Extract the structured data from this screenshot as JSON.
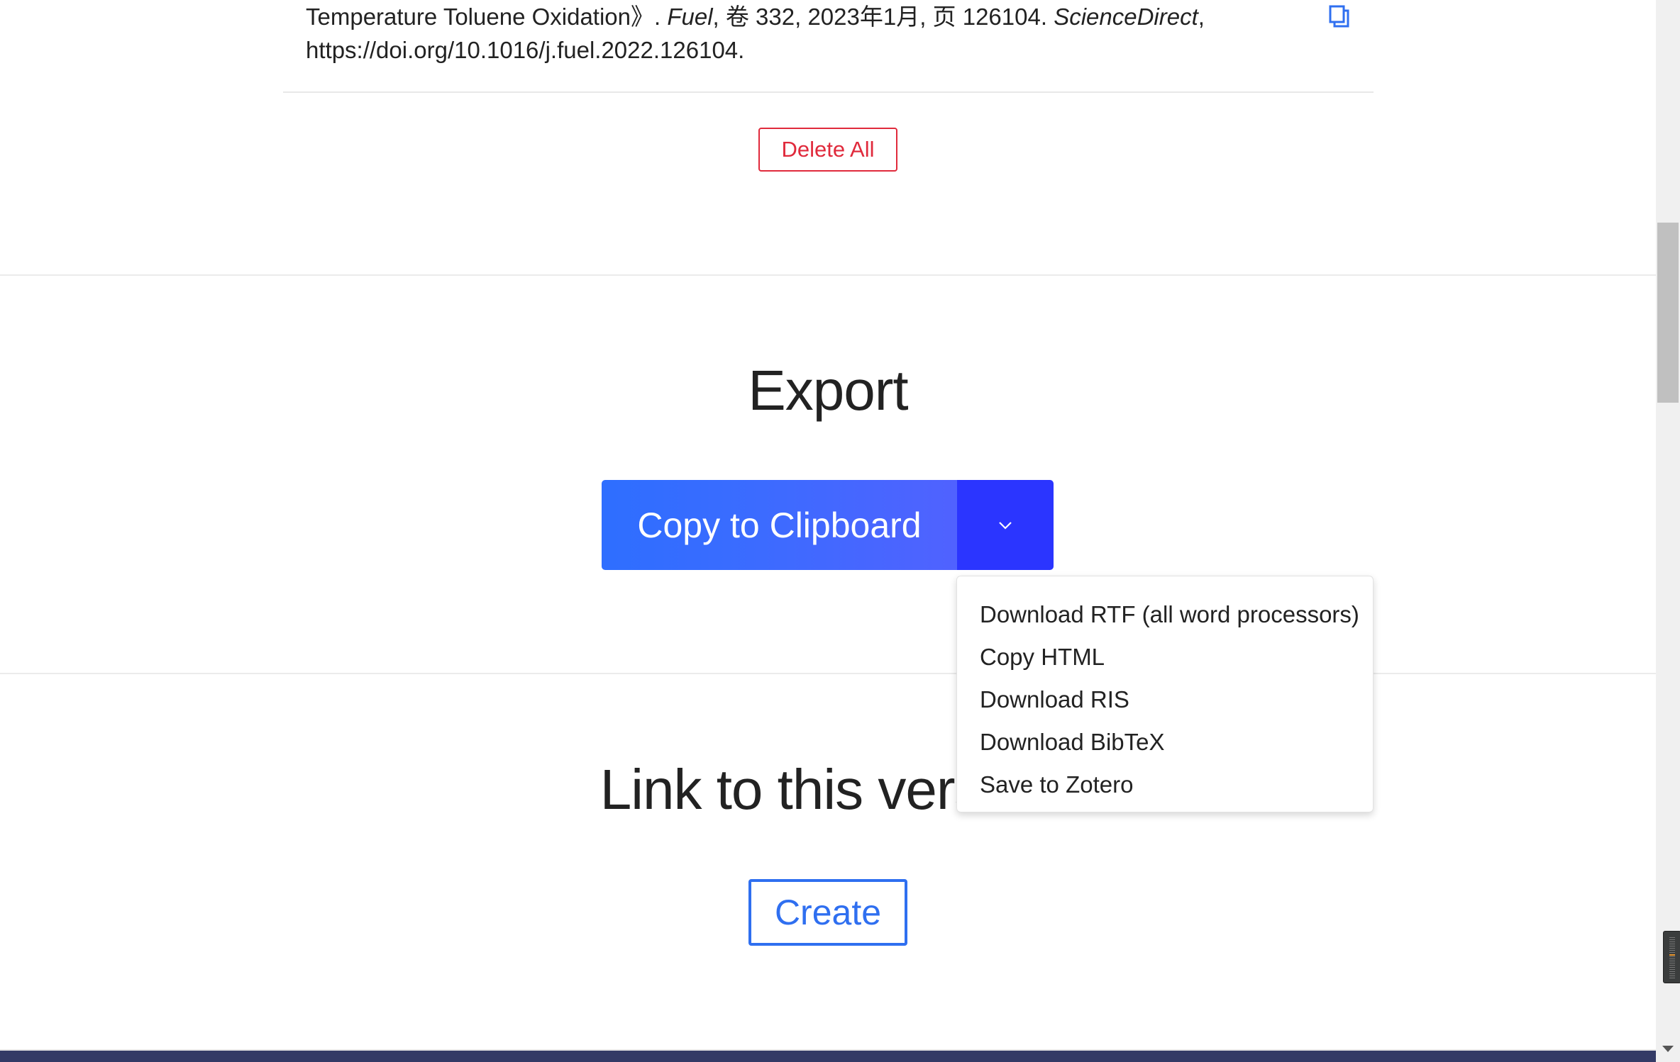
{
  "citation": {
    "line1_prefix": "Temperature Toluene Oxidation》. ",
    "journal": "Fuel",
    "line1_middle": ", 卷 332, 2023年1月, 页 126104. ",
    "database": "ScienceDirect",
    "line1_suffix": ",",
    "line2": "https://doi.org/10.1016/j.fuel.2022.126104.",
    "copy_icon": "copy-icon"
  },
  "actions": {
    "delete_all_label": "Delete All"
  },
  "export": {
    "heading": "Export",
    "primary_button_label": "Copy to Clipboard",
    "toggle_icon": "chevron-down-icon",
    "menu_items": [
      "Download RTF (all word processors)",
      "Copy HTML",
      "Download RIS",
      "Download BibTeX",
      "Save to Zotero"
    ]
  },
  "link_version": {
    "heading": "Link to this version",
    "create_label": "Create"
  },
  "colors": {
    "accent_blue": "#2f6ff0",
    "split_toggle_blue": "#2b35ff",
    "danger_red": "#e02a3c",
    "footer_navy": "#333a66"
  }
}
